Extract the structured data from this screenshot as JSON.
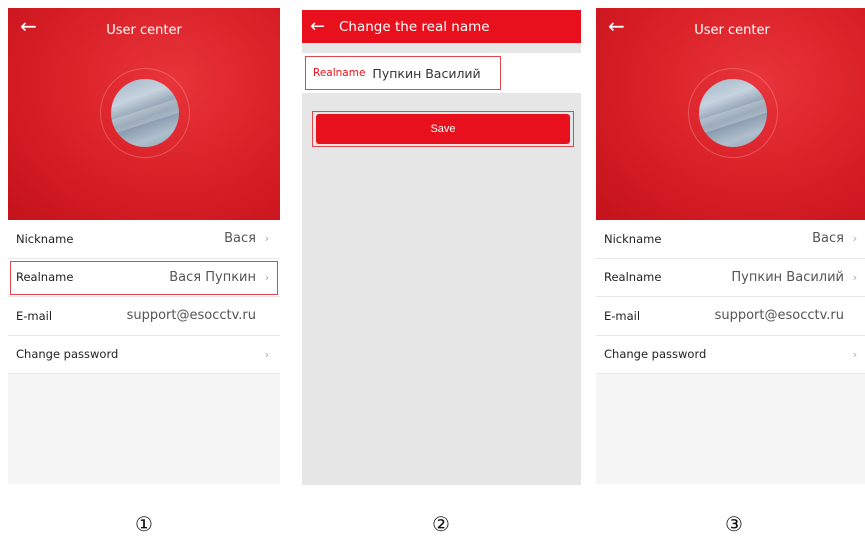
{
  "screens": [
    {
      "header": {
        "back_icon": "←",
        "title": "User center"
      },
      "rows": [
        {
          "label": "Nickname",
          "value": "Вася",
          "chevron": "›"
        },
        {
          "label": "Realname",
          "value": "Вася Пупкин",
          "chevron": "›",
          "highlighted": true
        },
        {
          "label": "E-mail",
          "value": "support@esocctv.ru",
          "chevron": ""
        },
        {
          "label": "Change password",
          "value": "",
          "chevron": "›"
        }
      ],
      "step_marker": "①"
    },
    {
      "header": {
        "back_icon": "←",
        "title": "Change the real name"
      },
      "field": {
        "label": "Realname",
        "value": "Пупкин Василий"
      },
      "save_label": "Save",
      "step_marker": "②"
    },
    {
      "header": {
        "back_icon": "←",
        "title": "User center"
      },
      "rows": [
        {
          "label": "Nickname",
          "value": "Вася",
          "chevron": "›"
        },
        {
          "label": "Realname",
          "value": "Пупкин Василий",
          "chevron": "›"
        },
        {
          "label": "E-mail",
          "value": "support@esocctv.ru",
          "chevron": ""
        },
        {
          "label": "Change password",
          "value": "",
          "chevron": "›"
        }
      ],
      "step_marker": "③"
    }
  ],
  "colors": {
    "accent_red": "#e8101c",
    "highlight_border": "#e0474c"
  },
  "icons": {
    "back": "arrow-left-icon",
    "chevron": "chevron-right-icon"
  }
}
